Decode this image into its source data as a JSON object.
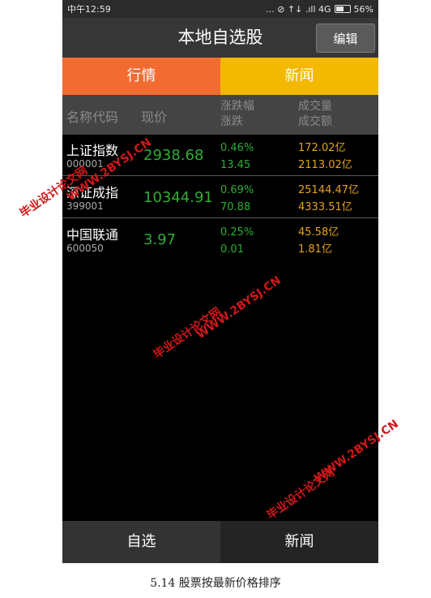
{
  "status_bar": {
    "time": "中午12:59",
    "signal_text": "... ⊘ ↑↓ .ıll 4G",
    "battery": "56%",
    "battery_level": 0.56
  },
  "header": {
    "title": "本地自选股",
    "edit_button": "编辑"
  },
  "tabs": [
    {
      "label": "行情"
    },
    {
      "label": "新闻"
    }
  ],
  "table": {
    "headers": {
      "name_code": "名称代码",
      "price": "现价",
      "change_pct": "涨跌幅",
      "change": "涨跌",
      "volume": "成交量",
      "turnover": "成交额"
    },
    "rows": [
      {
        "name": "上证指数",
        "code": "000001",
        "price": "2938.68",
        "change_pct": "0.46%",
        "change": "13.45",
        "volume": "172.02亿",
        "turnover": "2113.02亿"
      },
      {
        "name": "深证成指",
        "code": "399001",
        "price": "10344.91",
        "change_pct": "0.69%",
        "change": "70.88",
        "volume": "25144.47亿",
        "turnover": "4333.51亿"
      },
      {
        "name": "中国联通",
        "code": "600050",
        "price": "3.97",
        "change_pct": "0.25%",
        "change": "0.01",
        "volume": "45.58亿",
        "turnover": "1.81亿"
      }
    ]
  },
  "bottom_nav": [
    {
      "label": "自选"
    },
    {
      "label": "新闻"
    }
  ],
  "caption": "5.14 股票按最新价格排序",
  "watermarks": {
    "line1": "毕业设计论文网",
    "line2": "WWW.2BYSJ.CN"
  },
  "colors": {
    "tab_active": "#f26b31",
    "tab_news": "#f3b800",
    "up_green": "#2eae35",
    "volume_orange": "#e6a317",
    "watermark_red": "#d01818"
  }
}
